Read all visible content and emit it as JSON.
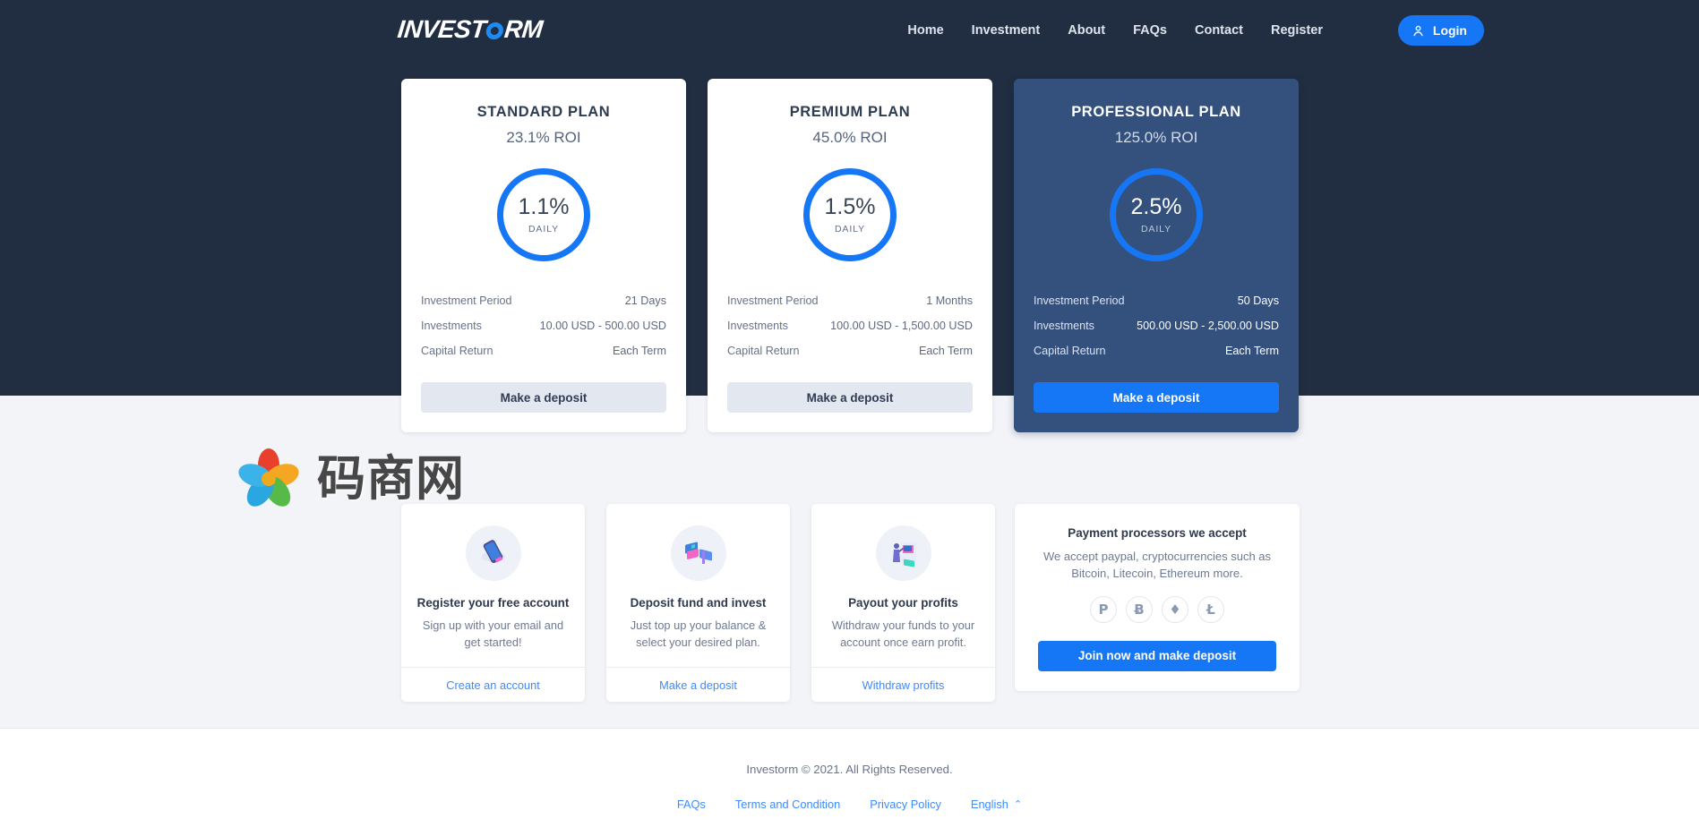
{
  "brand": {
    "logo_pre": "INVEST",
    "logo_o": "O",
    "logo_post": "RM",
    "accent": "#1577f5",
    "hero_bg": "#212e42",
    "featured_bg": "#34517d"
  },
  "nav": {
    "items": [
      {
        "label": "Home"
      },
      {
        "label": "Investment"
      },
      {
        "label": "About"
      },
      {
        "label": "FAQs"
      },
      {
        "label": "Contact"
      },
      {
        "label": "Register"
      }
    ],
    "login_label": "Login",
    "login_icon": "user-icon"
  },
  "plans": [
    {
      "title": "STANDARD PLAN",
      "roi": "23.1% ROI",
      "rate": "1.1%",
      "rate_sub": "DAILY",
      "rows": [
        {
          "label": "Investment Period",
          "value": "21 Days"
        },
        {
          "label": "Investments",
          "value": "10.00 USD - 500.00 USD"
        },
        {
          "label": "Capital Return",
          "value": "Each Term"
        }
      ],
      "cta": "Make a deposit",
      "featured": false
    },
    {
      "title": "PREMIUM PLAN",
      "roi": "45.0% ROI",
      "rate": "1.5%",
      "rate_sub": "DAILY",
      "rows": [
        {
          "label": "Investment Period",
          "value": "1 Months"
        },
        {
          "label": "Investments",
          "value": "100.00 USD - 1,500.00 USD"
        },
        {
          "label": "Capital Return",
          "value": "Each Term"
        }
      ],
      "cta": "Make a deposit",
      "featured": false
    },
    {
      "title": "PROFESSIONAL PLAN",
      "roi": "125.0% ROI",
      "rate": "2.5%",
      "rate_sub": "DAILY",
      "rows": [
        {
          "label": "Investment Period",
          "value": "50 Days"
        },
        {
          "label": "Investments",
          "value": "500.00 USD - 2,500.00 USD"
        },
        {
          "label": "Capital Return",
          "value": "Each Term"
        }
      ],
      "cta": "Make a deposit",
      "featured": true
    }
  ],
  "features": [
    {
      "icon": "smartphone-illustration",
      "title": "Register your free account",
      "desc": "Sign up with your email and get started!",
      "link": "Create an account"
    },
    {
      "icon": "cards-illustration",
      "title": "Deposit fund and invest",
      "desc": "Just top up your balance & select your desired plan.",
      "link": "Make a deposit"
    },
    {
      "icon": "atm-illustration",
      "title": "Payout your profits",
      "desc": "Withdraw your funds to your account once earn profit.",
      "link": "Withdraw profits"
    }
  ],
  "payment": {
    "title": "Payment processors we accept",
    "desc": "We accept paypal, cryptocurrencies such as Bitcoin, Litecoin, Ethereum more.",
    "icons": [
      {
        "name": "paypal-icon",
        "glyph": "P"
      },
      {
        "name": "bitcoin-icon",
        "glyph": "Ƀ"
      },
      {
        "name": "ethereum-icon",
        "glyph": "♦"
      },
      {
        "name": "litecoin-icon",
        "glyph": "Ł"
      }
    ],
    "cta": "Join now and make deposit"
  },
  "watermark": {
    "text": "码商网",
    "petal_colors": [
      "#e8402a",
      "#f5a623",
      "#56b948",
      "#2aa7e0",
      "#3bb3e8"
    ]
  },
  "footer": {
    "copyright": "Investorm © 2021. All Rights Reserved.",
    "links": [
      {
        "label": "FAQs"
      },
      {
        "label": "Terms and Condition"
      },
      {
        "label": "Privacy Policy"
      }
    ],
    "language": "English",
    "language_caret": "⌃"
  }
}
